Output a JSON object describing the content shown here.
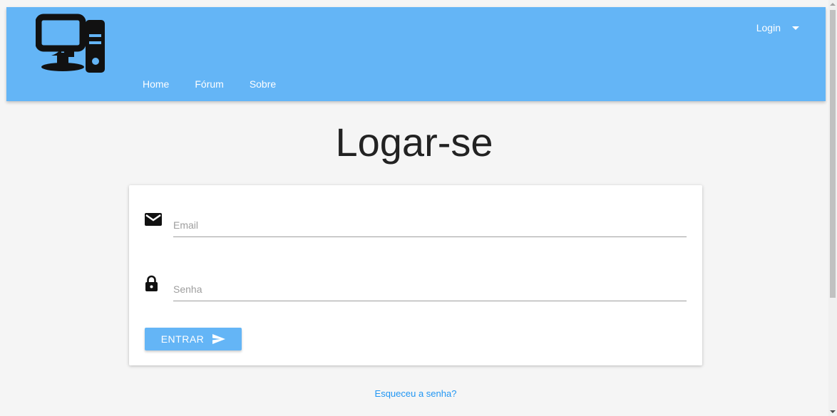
{
  "header": {
    "nav": [
      {
        "label": "Home"
      },
      {
        "label": "Fórum"
      },
      {
        "label": "Sobre"
      }
    ],
    "login_menu_label": "Login",
    "logo_icon": "desktop-computer-icon"
  },
  "main": {
    "title": "Logar-se",
    "email": {
      "placeholder": "Email",
      "value": "",
      "icon": "envelope-icon"
    },
    "password": {
      "placeholder": "Senha",
      "value": "",
      "icon": "lock-icon"
    },
    "submit_label": "ENTRAR",
    "submit_icon": "send-icon",
    "forgot_link": "Esqueceu a senha?"
  },
  "colors": {
    "navbar": "#64b5f6",
    "button": "#64b5f6",
    "link": "#2196f3",
    "background": "#f5f5f5"
  }
}
